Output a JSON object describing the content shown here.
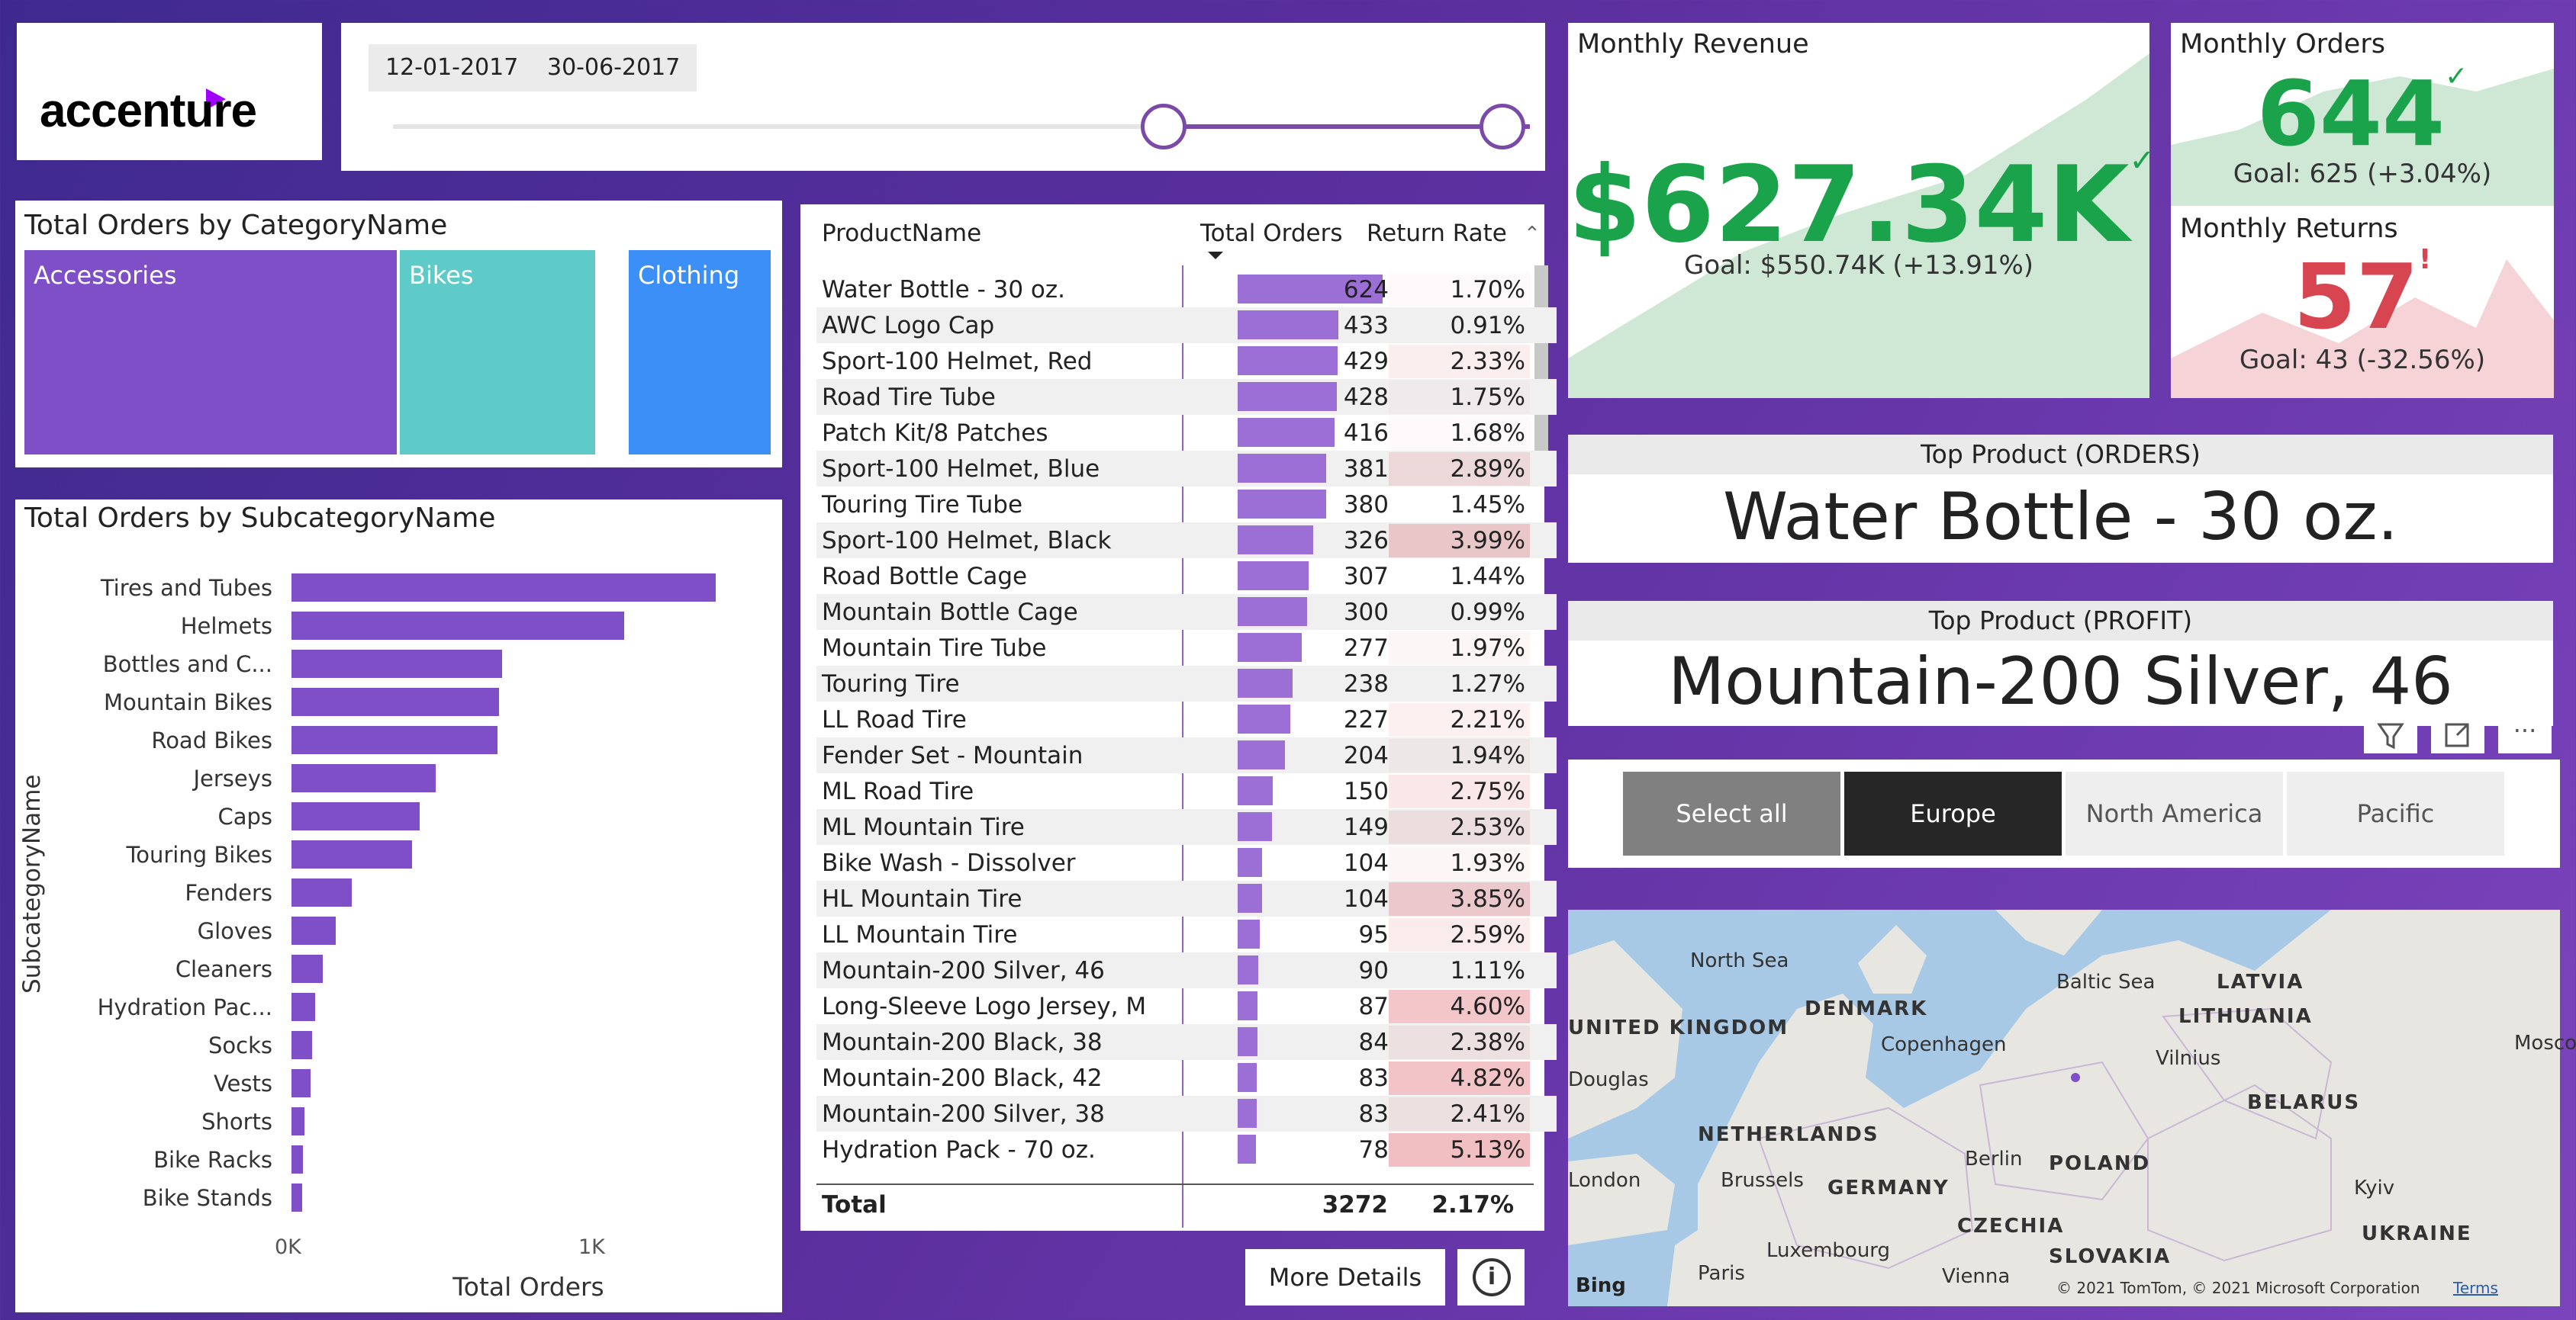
{
  "brand": {
    "logo_text": "accenture"
  },
  "date_slicer": {
    "start": "12-01-2017",
    "end": "30-06-2017"
  },
  "category_chart": {
    "title": "Total Orders by CategoryName",
    "tiles": [
      {
        "label": "Accessories",
        "color": "#7e4fc6"
      },
      {
        "label": "Bikes",
        "color": "#5ecbc8"
      },
      {
        "label": "Clothing",
        "color": "#3b8ff6"
      }
    ]
  },
  "chart_data": {
    "type": "bar",
    "title": "Total Orders by SubcategoryName",
    "xlabel": "Total Orders",
    "ylabel": "SubcategoryName",
    "x_ticks": [
      "0K",
      "1K"
    ],
    "xlim": [
      0,
      1550
    ],
    "categories": [
      "Tires and Tubes",
      "Helmets",
      "Bottles and C...",
      "Mountain Bikes",
      "Road Bikes",
      "Jerseys",
      "Caps",
      "Touring Bikes",
      "Fenders",
      "Gloves",
      "Cleaners",
      "Hydration Pac...",
      "Socks",
      "Vests",
      "Shorts",
      "Bike Racks",
      "Bike Stands"
    ],
    "values": [
      1440,
      1130,
      715,
      705,
      700,
      490,
      435,
      410,
      205,
      150,
      105,
      80,
      70,
      65,
      45,
      40,
      35
    ],
    "color": "#7e4fc6"
  },
  "table": {
    "columns": [
      "ProductName",
      "Total Orders",
      "Return Rate"
    ],
    "rows": [
      {
        "name": "Water Bottle - 30 oz.",
        "orders": "624",
        "rate": "1.70%",
        "o": 624,
        "r": 1.7
      },
      {
        "name": "AWC Logo Cap",
        "orders": "433",
        "rate": "0.91%",
        "o": 433,
        "r": 0.91
      },
      {
        "name": "Sport-100 Helmet, Red",
        "orders": "429",
        "rate": "2.33%",
        "o": 429,
        "r": 2.33
      },
      {
        "name": "Road Tire Tube",
        "orders": "428",
        "rate": "1.75%",
        "o": 428,
        "r": 1.75
      },
      {
        "name": "Patch Kit/8 Patches",
        "orders": "416",
        "rate": "1.68%",
        "o": 416,
        "r": 1.68
      },
      {
        "name": "Sport-100 Helmet, Blue",
        "orders": "381",
        "rate": "2.89%",
        "o": 381,
        "r": 2.89
      },
      {
        "name": "Touring Tire Tube",
        "orders": "380",
        "rate": "1.45%",
        "o": 380,
        "r": 1.45
      },
      {
        "name": "Sport-100 Helmet, Black",
        "orders": "326",
        "rate": "3.99%",
        "o": 326,
        "r": 3.99
      },
      {
        "name": "Road Bottle Cage",
        "orders": "307",
        "rate": "1.44%",
        "o": 307,
        "r": 1.44
      },
      {
        "name": "Mountain Bottle Cage",
        "orders": "300",
        "rate": "0.99%",
        "o": 300,
        "r": 0.99
      },
      {
        "name": "Mountain Tire Tube",
        "orders": "277",
        "rate": "1.97%",
        "o": 277,
        "r": 1.97
      },
      {
        "name": "Touring Tire",
        "orders": "238",
        "rate": "1.27%",
        "o": 238,
        "r": 1.27
      },
      {
        "name": "LL Road Tire",
        "orders": "227",
        "rate": "2.21%",
        "o": 227,
        "r": 2.21
      },
      {
        "name": "Fender Set - Mountain",
        "orders": "204",
        "rate": "1.94%",
        "o": 204,
        "r": 1.94
      },
      {
        "name": "ML Road Tire",
        "orders": "150",
        "rate": "2.75%",
        "o": 150,
        "r": 2.75
      },
      {
        "name": "ML Mountain Tire",
        "orders": "149",
        "rate": "2.53%",
        "o": 149,
        "r": 2.53
      },
      {
        "name": "Bike Wash - Dissolver",
        "orders": "104",
        "rate": "1.93%",
        "o": 104,
        "r": 1.93
      },
      {
        "name": "HL Mountain Tire",
        "orders": "104",
        "rate": "3.85%",
        "o": 104,
        "r": 3.85
      },
      {
        "name": "LL Mountain Tire",
        "orders": "95",
        "rate": "2.59%",
        "o": 95,
        "r": 2.59
      },
      {
        "name": "Mountain-200 Silver, 46",
        "orders": "90",
        "rate": "1.11%",
        "o": 90,
        "r": 1.11
      },
      {
        "name": "Long-Sleeve Logo Jersey, M",
        "orders": "87",
        "rate": "4.60%",
        "o": 87,
        "r": 4.6
      },
      {
        "name": "Mountain-200 Black, 38",
        "orders": "84",
        "rate": "2.38%",
        "o": 84,
        "r": 2.38
      },
      {
        "name": "Mountain-200 Black, 42",
        "orders": "83",
        "rate": "4.82%",
        "o": 83,
        "r": 4.82
      },
      {
        "name": "Mountain-200 Silver, 38",
        "orders": "83",
        "rate": "2.41%",
        "o": 83,
        "r": 2.41
      },
      {
        "name": "Hydration Pack - 70 oz.",
        "orders": "78",
        "rate": "5.13%",
        "o": 78,
        "r": 5.13
      }
    ],
    "total_label": "Total",
    "total_orders": "3272",
    "total_rate": "2.17%"
  },
  "kpi": {
    "revenue": {
      "title": "Monthly Revenue",
      "value": "$627.34K",
      "goal": "Goal: $550.74K (+13.91%)",
      "color": "#1aa34a"
    },
    "orders": {
      "title": "Monthly Orders",
      "value": "644",
      "goal": "Goal: 625 (+3.04%)",
      "color": "#1aa34a"
    },
    "returns": {
      "title": "Monthly Returns",
      "value": "57",
      "goal": "Goal: 43 (-32.56%)",
      "color": "#d64550"
    }
  },
  "top_orders": {
    "header": "Top Product (ORDERS)",
    "value": "Water Bottle - 30 oz."
  },
  "top_profit": {
    "header": "Top Product (PROFIT)",
    "value": "Mountain-200 Silver, 46"
  },
  "region_slicer": {
    "buttons": [
      {
        "label": "Select all",
        "state": "partial"
      },
      {
        "label": "Europe",
        "state": "selected"
      },
      {
        "label": "North America",
        "state": "off"
      },
      {
        "label": "Pacific",
        "state": "off"
      }
    ]
  },
  "map": {
    "labels": [
      "North Sea",
      "DENMARK",
      "Baltic Sea",
      "LATVIA",
      "LITHUANIA",
      "UNITED KINGDOM",
      "Copenhagen",
      "Vilnius",
      "Mosco",
      "Douglas",
      "BELARUS",
      "NETHERLANDS",
      "Berlin",
      "POLAND",
      "London",
      "Brussels",
      "GERMANY",
      "Kyiv",
      "CZECHIA",
      "Luxembourg",
      "SLOVAKIA",
      "UKRAINE",
      "Paris",
      "Vienna"
    ],
    "attribution": "© 2021 TomTom, © 2021 Microsoft Corporation",
    "terms": "Terms",
    "bing": "Bing"
  },
  "buttons": {
    "more_details": "More Details"
  }
}
